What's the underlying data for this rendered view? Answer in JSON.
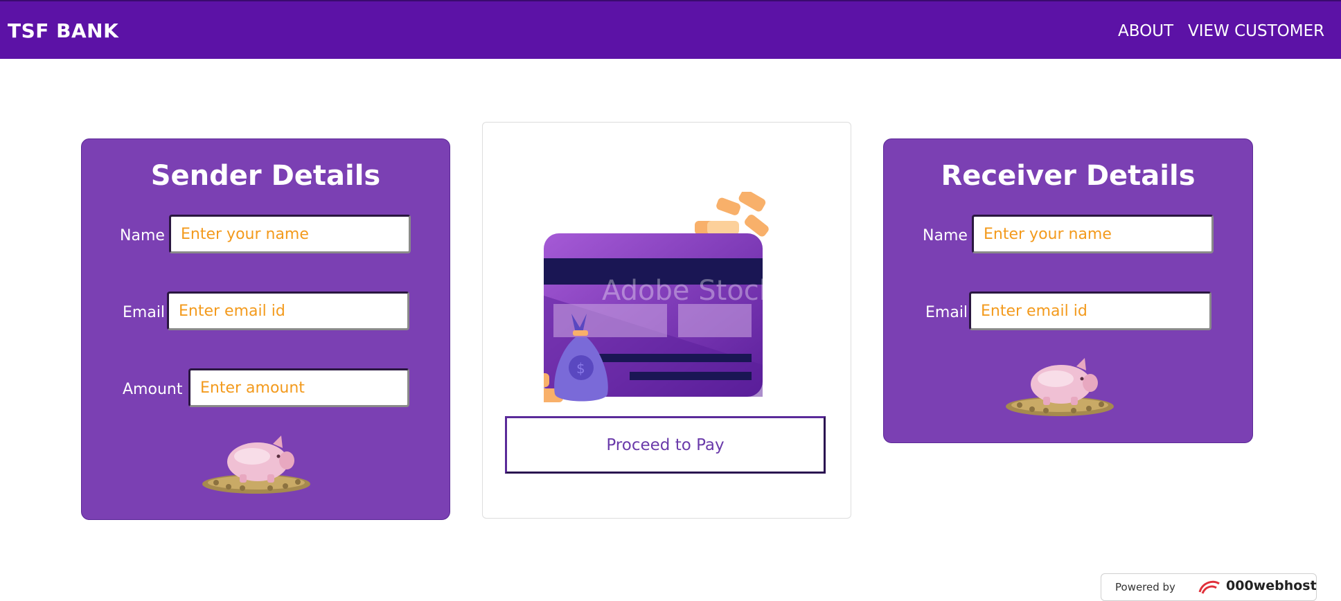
{
  "navbar": {
    "brand": "TSF BANK",
    "links": [
      "ABOUT",
      "VIEW CUSTOMER"
    ]
  },
  "sender": {
    "title": "Sender Details",
    "name_label": "Name",
    "name_placeholder": "Enter your name",
    "email_label": "Email",
    "email_placeholder": "Enter email id",
    "amount_label": "Amount",
    "amount_placeholder": "Enter amount"
  },
  "receiver": {
    "title": "Receiver Details",
    "name_label": "Name",
    "name_placeholder": "Enter your name",
    "email_label": "Email",
    "email_placeholder": "Enter email id"
  },
  "payment": {
    "watermark": "Adobe Stock",
    "button_label": "Proceed to Pay"
  },
  "footer": {
    "powered_by": "Powered by",
    "brand": "000webhost"
  },
  "colors": {
    "navbar": "#5c12a6",
    "card": "#7b40b3",
    "placeholder": "#f39a1c"
  },
  "icons": [
    "piggy-bank-icon",
    "credit-card-icon",
    "money-bag-icon",
    "coins-icon"
  ]
}
